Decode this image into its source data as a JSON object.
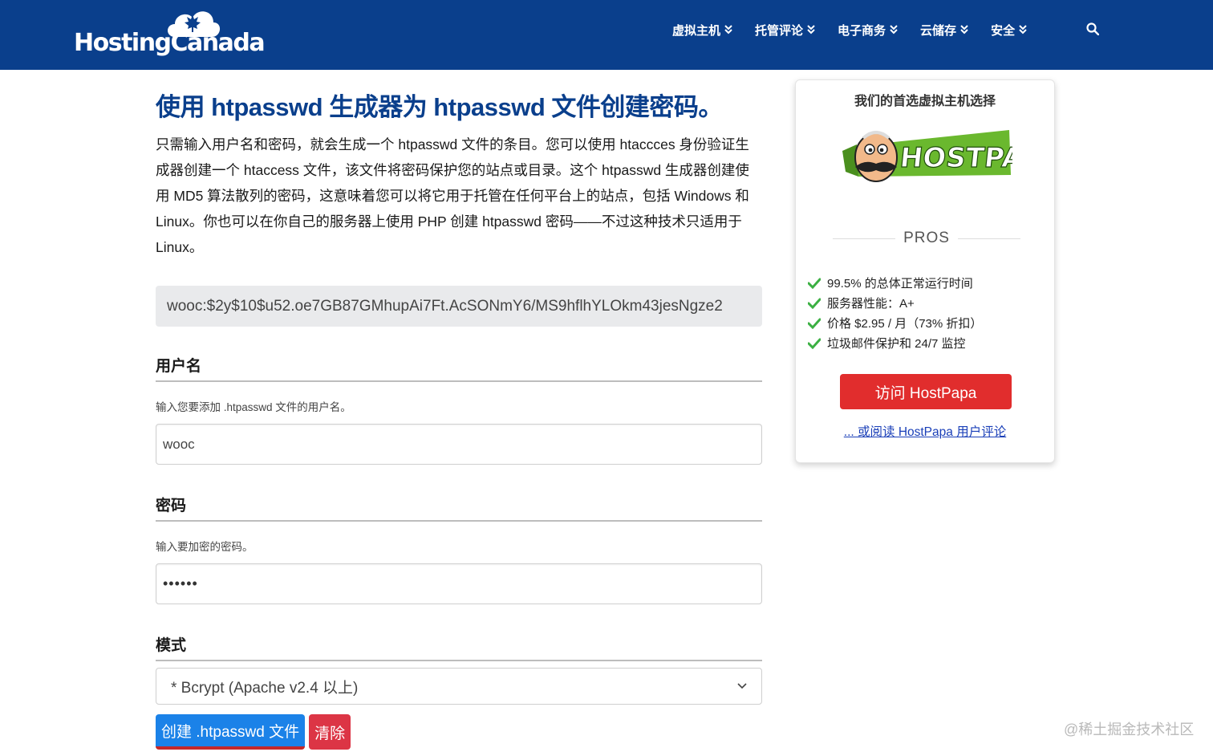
{
  "header": {
    "logo_text": "HostingCanada",
    "nav": [
      {
        "label": "虚拟主机"
      },
      {
        "label": "托管评论"
      },
      {
        "label": "电子商务"
      },
      {
        "label": "云储存"
      },
      {
        "label": "安全"
      }
    ],
    "icons": {
      "search": "search-icon",
      "chevron": "double-chevron-down-icon"
    }
  },
  "main": {
    "title": "使用 htpasswd 生成器为 htpasswd 文件创建密码。",
    "intro": "只需输入用户名和密码，就会生成一个 htpasswd 文件的条目。您可以使用 htaccces 身份验证生成器创建一个 htaccess 文件，该文件将密码保护您的站点或目录。这个 htpasswd 生成器创建使用 MD5 算法散列的密码，这意味着您可以将它用于托管在任何平台上的站点，包括 Windows 和 Linux。你也可以在你自己的服务器上使用 PHP 创建 htpasswd 密码——不过这种技术只适用于 Linux。",
    "output": "wooc:$2y$10$u52.oe7GB87GMhupAi7Ft.AcSONmY6/MS9hflhYLOkm43jesNgze2",
    "username": {
      "title": "用户名",
      "help": "输入您要添加 .htpasswd 文件的用户名。",
      "value": "wooc"
    },
    "password": {
      "title": "密码",
      "help": "输入要加密的密码。",
      "value": "••••••"
    },
    "mode": {
      "title": "模式",
      "selected": "* Bcrypt (Apache v2.4 以上)"
    },
    "buttons": {
      "create": "创建 .htpasswd 文件",
      "clear": "清除"
    }
  },
  "sidebar": {
    "title": "我们的首选虚拟主机选择",
    "brand": "HOSTPAPA",
    "pros_label": "PROS",
    "pros": [
      "99.5% 的总体正常运行时间",
      "服务器性能：A+",
      "价格 $2.95 / 月（73% 折扣）",
      "垃圾邮件保护和 24/7 监控"
    ],
    "visit_button": "访问 HostPapa",
    "review_link": "... 或阅读 HostPapa 用户评论",
    "colors": {
      "check": "#3cb043",
      "visit": "#e12d2d",
      "brand_green": "#6ab82e"
    }
  },
  "watermark": "@稀土掘金技术社区",
  "colors": {
    "header": "#0a3f8c",
    "title": "#0a3f8c",
    "primary": "#1b82e8",
    "danger": "#dc3545"
  }
}
